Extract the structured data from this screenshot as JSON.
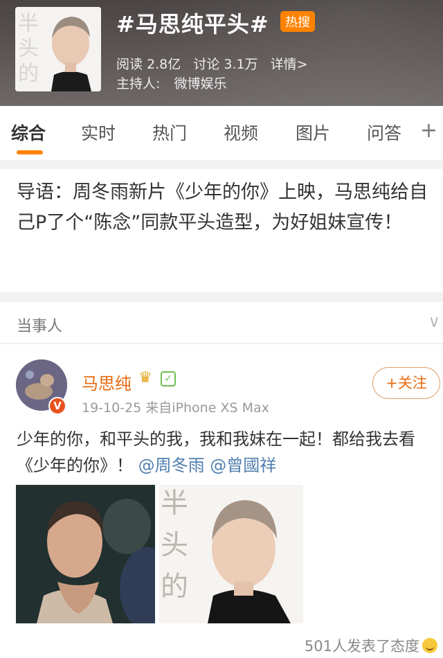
{
  "header": {
    "cover_text": "半头的",
    "title": "#马思纯平头#",
    "badge": "热搜",
    "stats": {
      "read": "阅读 2.8亿",
      "discuss": "讨论 3.1万",
      "details": "详情>"
    },
    "host_label": "主持人:",
    "host_name": "微博娱乐"
  },
  "tabs": [
    {
      "label": "综合",
      "active": true
    },
    {
      "label": "实时"
    },
    {
      "label": "热门"
    },
    {
      "label": "视频"
    },
    {
      "label": "图片"
    },
    {
      "label": "问答"
    }
  ],
  "tab_more": "+",
  "lead": {
    "text": "导语：周冬雨新片《少年的你》上映，马思纯给自己P了个“陈念”同款平头造型，为好姐妹宣传！"
  },
  "participants": {
    "title": "当事人",
    "chevron": "∨"
  },
  "post": {
    "username": "马思纯",
    "verified": "V",
    "follow_label": "+关注",
    "meta": "19-10-25  来自iPhone XS Max",
    "text": "少年的你，和平头的我，我和我妹在一起！都给我去看《少年的你》！",
    "mentions": [
      "@周冬雨",
      "@曾國祥"
    ],
    "photo_overlay_text": [
      "半",
      "头",
      "的"
    ]
  },
  "reactions": {
    "text": "501人发表了态度"
  },
  "colors": {
    "accent": "#ff8200",
    "username": "#e86b0f",
    "mention": "#507daf"
  }
}
